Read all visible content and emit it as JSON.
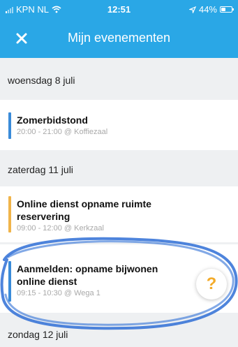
{
  "status_bar": {
    "carrier": "KPN NL",
    "time": "12:51",
    "battery": "44%"
  },
  "header": {
    "title": "Mijn evenementen",
    "close_icon": "close-icon"
  },
  "sections": [
    {
      "date": "woensdag 8 juli",
      "events": [
        {
          "title": "Zomerbidstond",
          "meta": "20:00 - 21:00 @ Koffiezaal",
          "color": "#3a8bd9"
        }
      ]
    },
    {
      "date": "zaterdag 11 juli",
      "events": [
        {
          "title": "Online dienst opname ruimte reservering",
          "meta": "09:00 - 12:00 @ Kerkzaal",
          "color": "#f0b44a"
        },
        {
          "title": "Aanmelden: opname bijwonen online dienst",
          "meta": "09:15 - 10:30 @ Wega 1",
          "color": "#3a8bd9"
        }
      ]
    },
    {
      "date": "zondag 12 juli",
      "events": []
    }
  ],
  "help_button": {
    "label": "?",
    "icon": "question-icon",
    "color": "#f3ab2a"
  },
  "colors": {
    "header": "#2aa7e6",
    "background": "#eef0f2",
    "annotation": "#2f6fd6"
  }
}
